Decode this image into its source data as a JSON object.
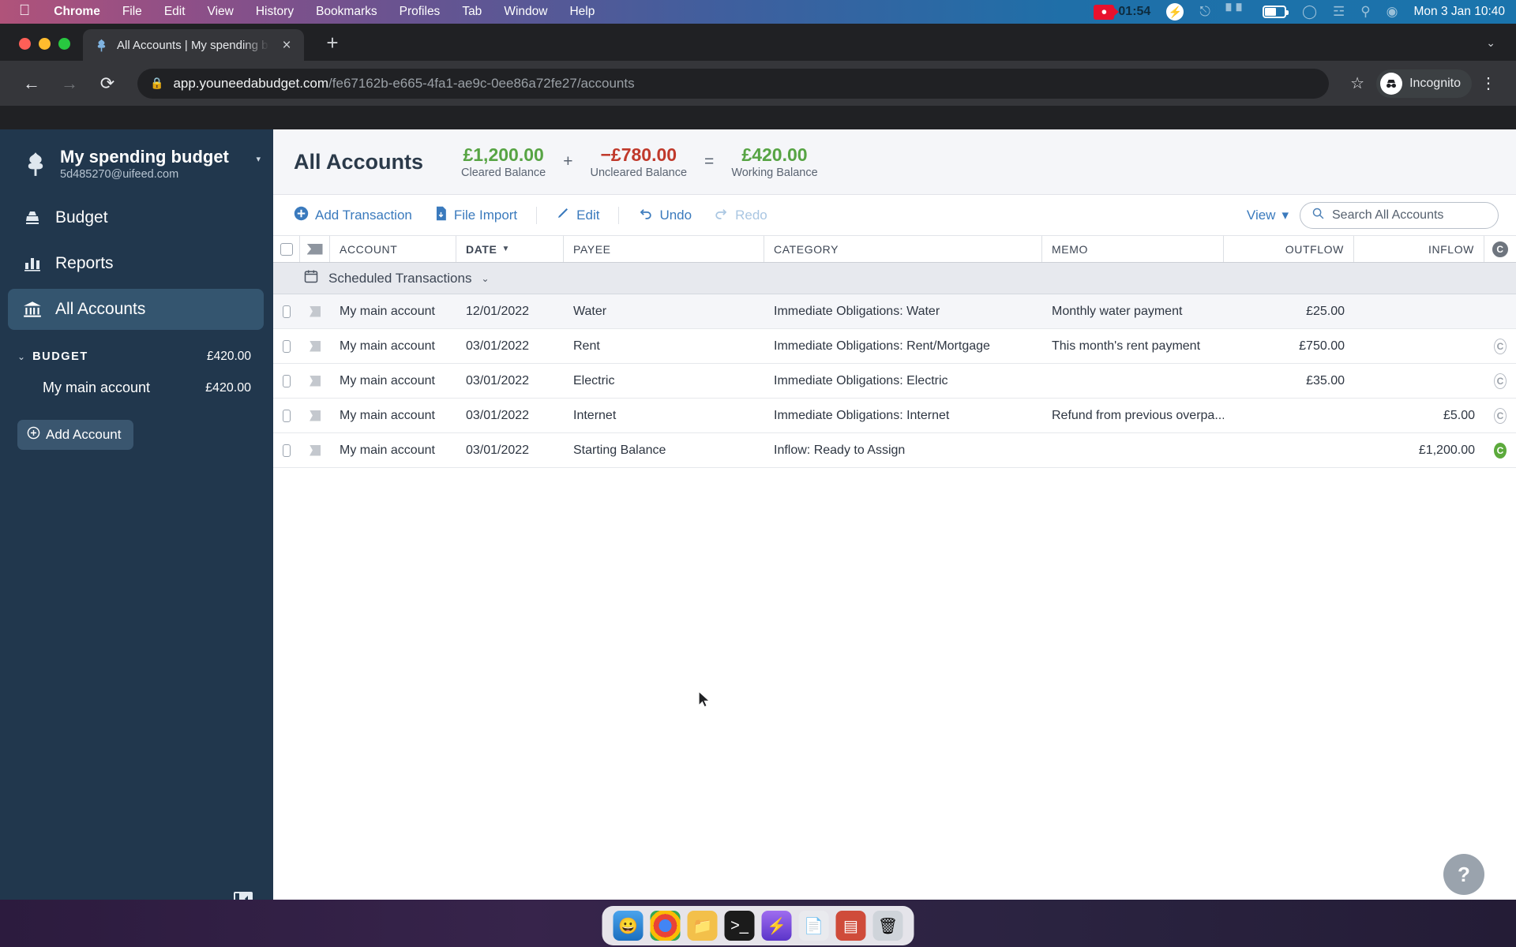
{
  "menubar": {
    "apple_icon": "apple-logo",
    "items": [
      "Chrome",
      "File",
      "Edit",
      "View",
      "History",
      "Bookmarks",
      "Profiles",
      "Tab",
      "Window",
      "Help"
    ],
    "recording_time": "01:54",
    "status_icons": [
      "screen-record-icon",
      "bolt-icon",
      "bluetooth-off-icon",
      "keyboard-brightness-icon",
      "battery-icon",
      "wifi-icon",
      "control-center-icon",
      "search-icon",
      "siri-icon"
    ],
    "clock": "Mon 3 Jan  10:40"
  },
  "browser": {
    "tab": {
      "title": "All Accounts | My spending bu",
      "favicon": "ynab-tree-icon",
      "close": "×"
    },
    "new_tab": "+",
    "tab_list_chevron": "⌄",
    "nav": {
      "back": "←",
      "forward": "→",
      "reload": "⟳"
    },
    "url": {
      "lock": "lock-icon",
      "host": "app.youneedabudget.com",
      "path": "/fe67162b-e665-4fa1-ae9c-0ee86a72fe27/accounts"
    },
    "bookmark_star": "☆",
    "profile": {
      "label": "Incognito",
      "icon": "incognito-icon"
    },
    "menu_kebab": "⋮"
  },
  "sidebar": {
    "budget_name": "My spending budget",
    "budget_email": "5d485270@uifeed.com",
    "budget_caret": "▾",
    "nav_items": [
      {
        "label": "Budget",
        "icon": "budget-icon",
        "active": false
      },
      {
        "label": "Reports",
        "icon": "reports-bar-chart-icon",
        "active": false
      },
      {
        "label": "All Accounts",
        "icon": "bank-icon",
        "active": true
      }
    ],
    "section": {
      "caret": "⌄",
      "label": "BUDGET",
      "amount": "£420.00"
    },
    "accounts": [
      {
        "name": "My main account",
        "amount": "£420.00"
      }
    ],
    "add_account": {
      "label": "Add Account",
      "icon": "plus-circle-icon"
    },
    "collapse_icon": "collapse-sidebar-icon"
  },
  "account_header": {
    "title": "All Accounts",
    "balances": [
      {
        "amount": "£1,200.00",
        "label": "Cleared Balance",
        "tone": "pos"
      },
      {
        "amount": "−£780.00",
        "label": "Uncleared Balance",
        "tone": "neg"
      },
      {
        "amount": "£420.00",
        "label": "Working Balance",
        "tone": "pos"
      }
    ],
    "operators": [
      "+",
      "="
    ]
  },
  "toolbar": {
    "add_transaction": "Add Transaction",
    "file_import": "File Import",
    "edit": "Edit",
    "undo": "Undo",
    "redo": "Redo",
    "view": "View",
    "view_caret": "▾",
    "search_placeholder": "Search All Accounts"
  },
  "table": {
    "headers": {
      "account": "ACCOUNT",
      "date": "DATE",
      "payee": "PAYEE",
      "category": "CATEGORY",
      "memo": "MEMO",
      "outflow": "OUTFLOW",
      "inflow": "INFLOW",
      "cleared": "C"
    },
    "sort_caret": "▼",
    "scheduled_group": {
      "label": "Scheduled Transactions",
      "caret": "⌄",
      "icon": "calendar-icon"
    },
    "rows": [
      {
        "account": "My main account",
        "date": "12/01/2022",
        "payee": "Water",
        "category": "Immediate Obligations: Water",
        "memo": "Monthly water payment",
        "outflow": "£25.00",
        "inflow": "",
        "cleared": "",
        "cleared_state": "none"
      },
      {
        "account": "My main account",
        "date": "03/01/2022",
        "payee": "Rent",
        "category": "Immediate Obligations: Rent/Mortgage",
        "memo": "This month's rent payment",
        "outflow": "£750.00",
        "inflow": "",
        "cleared": "C",
        "cleared_state": "uncleared"
      },
      {
        "account": "My main account",
        "date": "03/01/2022",
        "payee": "Electric",
        "category": "Immediate Obligations: Electric",
        "memo": "",
        "outflow": "£35.00",
        "inflow": "",
        "cleared": "C",
        "cleared_state": "uncleared"
      },
      {
        "account": "My main account",
        "date": "03/01/2022",
        "payee": "Internet",
        "category": "Immediate Obligations: Internet",
        "memo": "Refund from previous overpa...",
        "outflow": "",
        "inflow": "£5.00",
        "cleared": "C",
        "cleared_state": "uncleared"
      },
      {
        "account": "My main account",
        "date": "03/01/2022",
        "payee": "Starting Balance",
        "category": "Inflow: Ready to Assign",
        "memo": "",
        "outflow": "",
        "inflow": "£1,200.00",
        "cleared": "C",
        "cleared_state": "cleared"
      }
    ]
  },
  "help_button": "?",
  "dock": {
    "items": [
      "finder-icon",
      "chrome-icon",
      "files-icon",
      "terminal-icon",
      "bolt-icon",
      "notes-icon",
      "screenshot-icon",
      "trash-icon"
    ]
  },
  "colors": {
    "sidebar_bg": "#21374d",
    "accent_blue": "#3a7abd",
    "positive_green": "#57a444",
    "negative_red": "#c0392b"
  }
}
